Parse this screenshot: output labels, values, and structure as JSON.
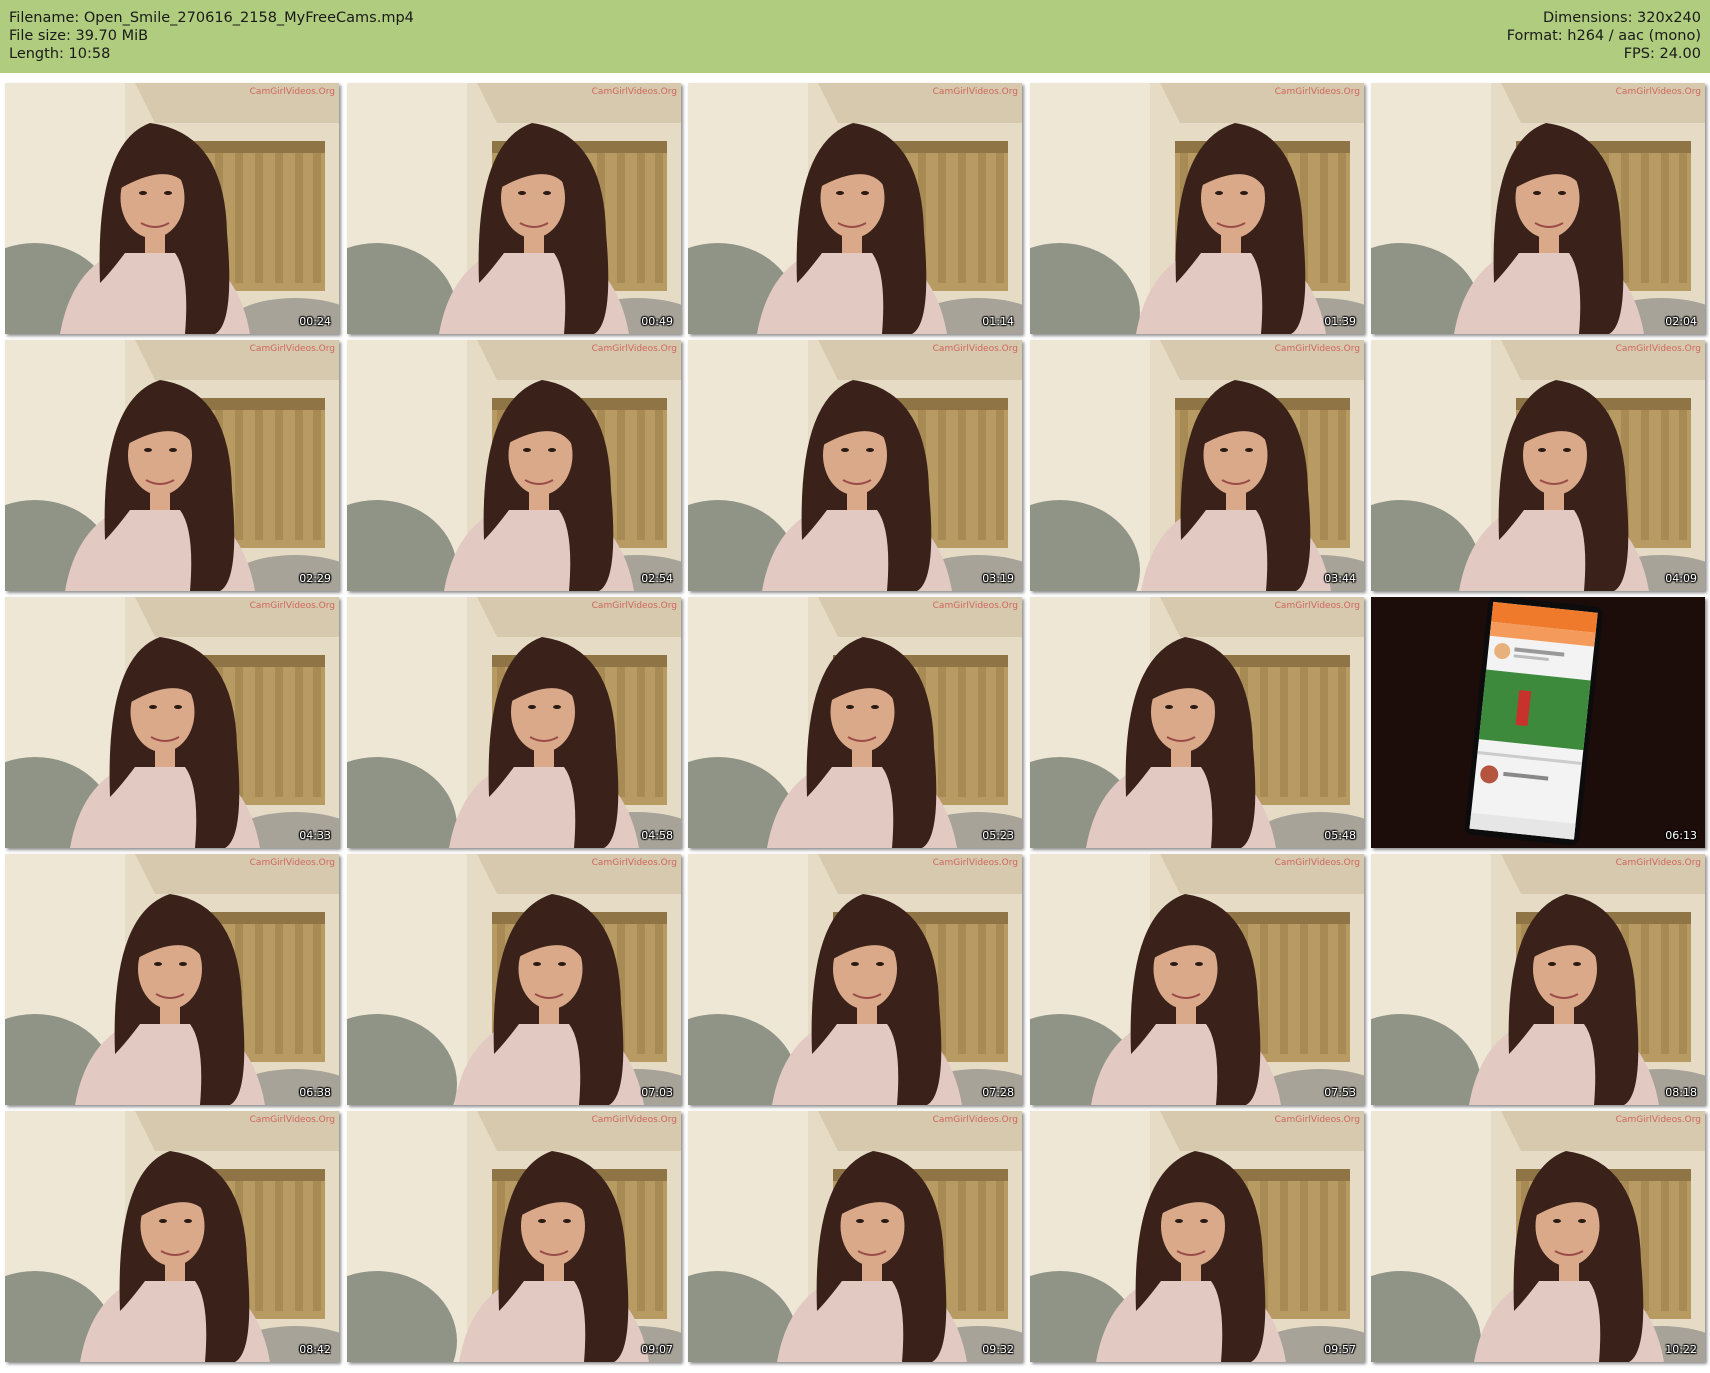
{
  "header": {
    "filename": "Filename: Open_Smile_270616_2158_MyFreeCams.mp4",
    "filesize": "File size: 39.70 MiB",
    "length": "Length: 10:58",
    "dimensions": "Dimensions: 320x240",
    "format": "Format: h264 / aac (mono)",
    "fps": "FPS: 24.00"
  },
  "watermark": "CamGirlVideos.Org",
  "thumbnails": [
    {
      "time": "00:24",
      "scene": "webcam"
    },
    {
      "time": "00:49",
      "scene": "webcam"
    },
    {
      "time": "01:14",
      "scene": "webcam"
    },
    {
      "time": "01:39",
      "scene": "webcam"
    },
    {
      "time": "02:04",
      "scene": "webcam"
    },
    {
      "time": "02:29",
      "scene": "webcam"
    },
    {
      "time": "02:54",
      "scene": "webcam"
    },
    {
      "time": "03:19",
      "scene": "webcam"
    },
    {
      "time": "03:44",
      "scene": "webcam"
    },
    {
      "time": "04:09",
      "scene": "webcam"
    },
    {
      "time": "04:33",
      "scene": "webcam"
    },
    {
      "time": "04:58",
      "scene": "webcam"
    },
    {
      "time": "05:23",
      "scene": "webcam"
    },
    {
      "time": "05:48",
      "scene": "webcam"
    },
    {
      "time": "06:13",
      "scene": "phone"
    },
    {
      "time": "06:38",
      "scene": "webcam"
    },
    {
      "time": "07:03",
      "scene": "webcam"
    },
    {
      "time": "07:28",
      "scene": "webcam"
    },
    {
      "time": "07:53",
      "scene": "webcam"
    },
    {
      "time": "08:18",
      "scene": "webcam"
    },
    {
      "time": "08:42",
      "scene": "webcam"
    },
    {
      "time": "09:07",
      "scene": "webcam"
    },
    {
      "time": "09:32",
      "scene": "webcam"
    },
    {
      "time": "09:57",
      "scene": "webcam"
    },
    {
      "time": "10:22",
      "scene": "webcam"
    }
  ],
  "colors": {
    "header_bg": "#b0cc7e",
    "wall": "#e6dcc6",
    "curtain": "#b89a63",
    "hair": "#3a221a",
    "sweater": "#e2c9c2",
    "skin": "#d9a98a",
    "pillow": "#8f9487"
  }
}
